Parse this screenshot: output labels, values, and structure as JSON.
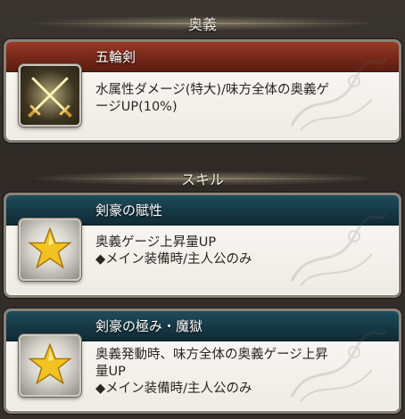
{
  "sections": {
    "ougi_header": "奥義",
    "skill_header": "スキル"
  },
  "ougi": {
    "name": "五輪剣",
    "description_line1": "水属性ダメージ(特大)/味方全体の奥義ゲ",
    "description_line2": "ージUP(10%)",
    "icon": "crossed-swords-icon"
  },
  "skills": [
    {
      "name": "剣豪の賦性",
      "line1": "奥義ゲージ上昇量UP",
      "line2": "◆メイン装備時/主人公のみ",
      "icon": "star-icon"
    },
    {
      "name": "剣豪の極み・魔獄",
      "line1": "奥義発動時、味方全体の奥義ゲージ上昇",
      "line2": "量UP",
      "line3": "◆メイン装備時/主人公のみ",
      "icon": "star-icon"
    }
  ],
  "colors": {
    "ougi_title_bar": "#7b2a1a",
    "skill_title_bar": "#163a47",
    "card_bg": "#f5f3ee",
    "background": "#312c28"
  }
}
